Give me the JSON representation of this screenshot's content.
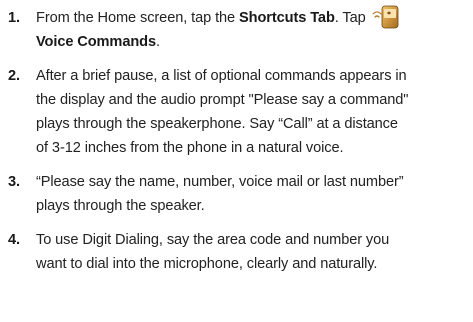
{
  "steps": [
    {
      "number": "1.",
      "line1_pre": "From the Home screen, tap the ",
      "line1_bold": "Shortcuts Tab",
      "line1_post": ". Tap",
      "icon": "voice-commands-app-icon",
      "line2_bold": "Voice Commands",
      "line2_post": "."
    },
    {
      "number": "2.",
      "lines": [
        "After a brief pause, a list of optional commands appears in",
        "the display and the audio prompt \"Please say a command\"",
        "plays through the speakerphone. Say “Call” at a distance",
        "of 3-12 inches from the phone in a natural voice."
      ]
    },
    {
      "number": "3.",
      "lines": [
        "“Please say the name, number, voice mail or last number”",
        "plays through the speaker."
      ]
    },
    {
      "number": "4.",
      "lines": [
        "To use Digit Dialing, say the area code and number you",
        "want to dial into the microphone, clearly and naturally."
      ]
    }
  ]
}
